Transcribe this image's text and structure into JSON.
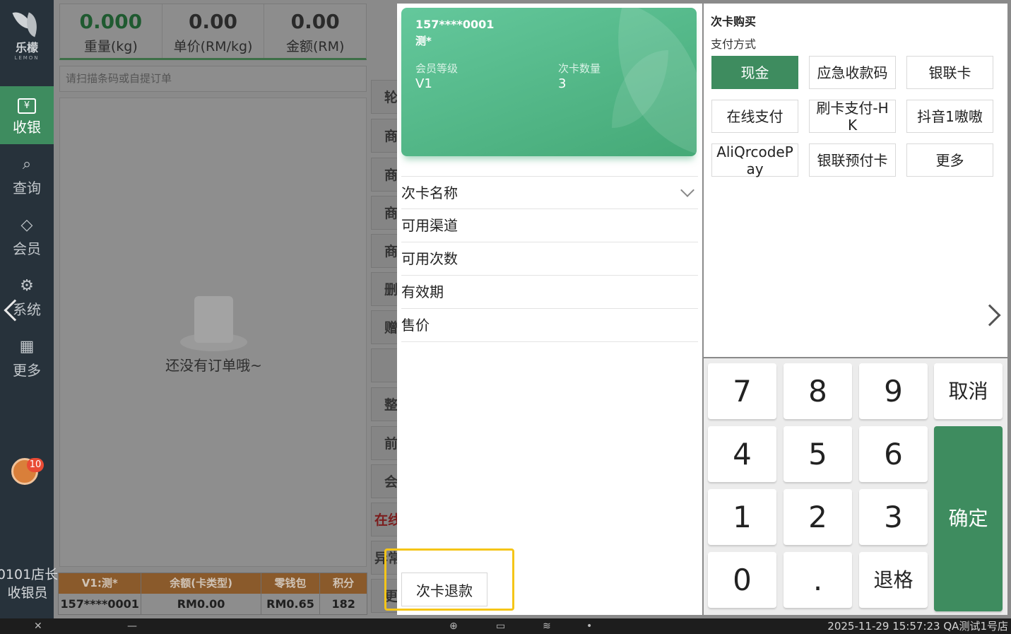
{
  "sidebar": {
    "logo_text": "乐檬",
    "logo_sub": "LEMON",
    "items": [
      {
        "label": "收银",
        "icon": "cashier-icon",
        "glyph": "¥"
      },
      {
        "label": "查询",
        "icon": "search-doc-icon",
        "glyph": "⌕"
      },
      {
        "label": "会员",
        "icon": "diamond-icon",
        "glyph": "◇"
      },
      {
        "label": "系统",
        "icon": "gear-icon",
        "glyph": "⚙"
      },
      {
        "label": "更多",
        "icon": "grid-icon",
        "glyph": "▦"
      }
    ],
    "badge_count": "10",
    "store_name": "0101店长",
    "role": "收银员"
  },
  "scale": {
    "weight_value": "0.000",
    "weight_label": "重量(kg)",
    "unit_price_value": "0.00",
    "unit_price_label": "单价(RM/kg)",
    "amount_value": "0.00",
    "amount_label": "金额(RM)"
  },
  "scan": {
    "placeholder": "请扫描条码或自提订单"
  },
  "orders": {
    "empty_text": "还没有订单哦~"
  },
  "member_table": {
    "headers": [
      "V1:测*",
      "余额(卡类型)",
      "零钱包",
      "积分"
    ],
    "row": [
      "157****0001",
      "RM0.00",
      "RM0.65",
      "182"
    ]
  },
  "func_col": [
    "轮",
    "商",
    "商",
    "商",
    "删",
    "赠",
    "",
    "整",
    "前",
    "会",
    "在线",
    "异常",
    "更"
  ],
  "card": {
    "phone": "157****0001",
    "name": "测*",
    "level_label": "会员等级",
    "level_value": "V1",
    "count_label": "次卡数量",
    "count_value": "3",
    "fields": [
      "次卡名称",
      "可用渠道",
      "可用次数",
      "有效期",
      "售价"
    ],
    "refund_label": "次卡退款"
  },
  "payment": {
    "title": "次卡购买",
    "subtitle": "支付方式",
    "methods": [
      "现金",
      "应急收款码",
      "银联卡",
      "在线支付",
      "刷卡支付-HK",
      "抖音1嗷嗷",
      "AliQrcodePay",
      "银联预付卡",
      "更多"
    ],
    "selected": "现金"
  },
  "keypad": {
    "keys": [
      "7",
      "8",
      "9",
      "取消",
      "4",
      "5",
      "6",
      "1",
      "2",
      "3",
      "0",
      ".",
      "退格",
      "确定"
    ]
  },
  "taskbar": {
    "datetime": "2025-11-29 15:57:23",
    "store": "QA测试1号店"
  },
  "colors": {
    "brand_green": "#3e8c5f",
    "card_green": "#55b985",
    "highlight": "#f5c518"
  }
}
